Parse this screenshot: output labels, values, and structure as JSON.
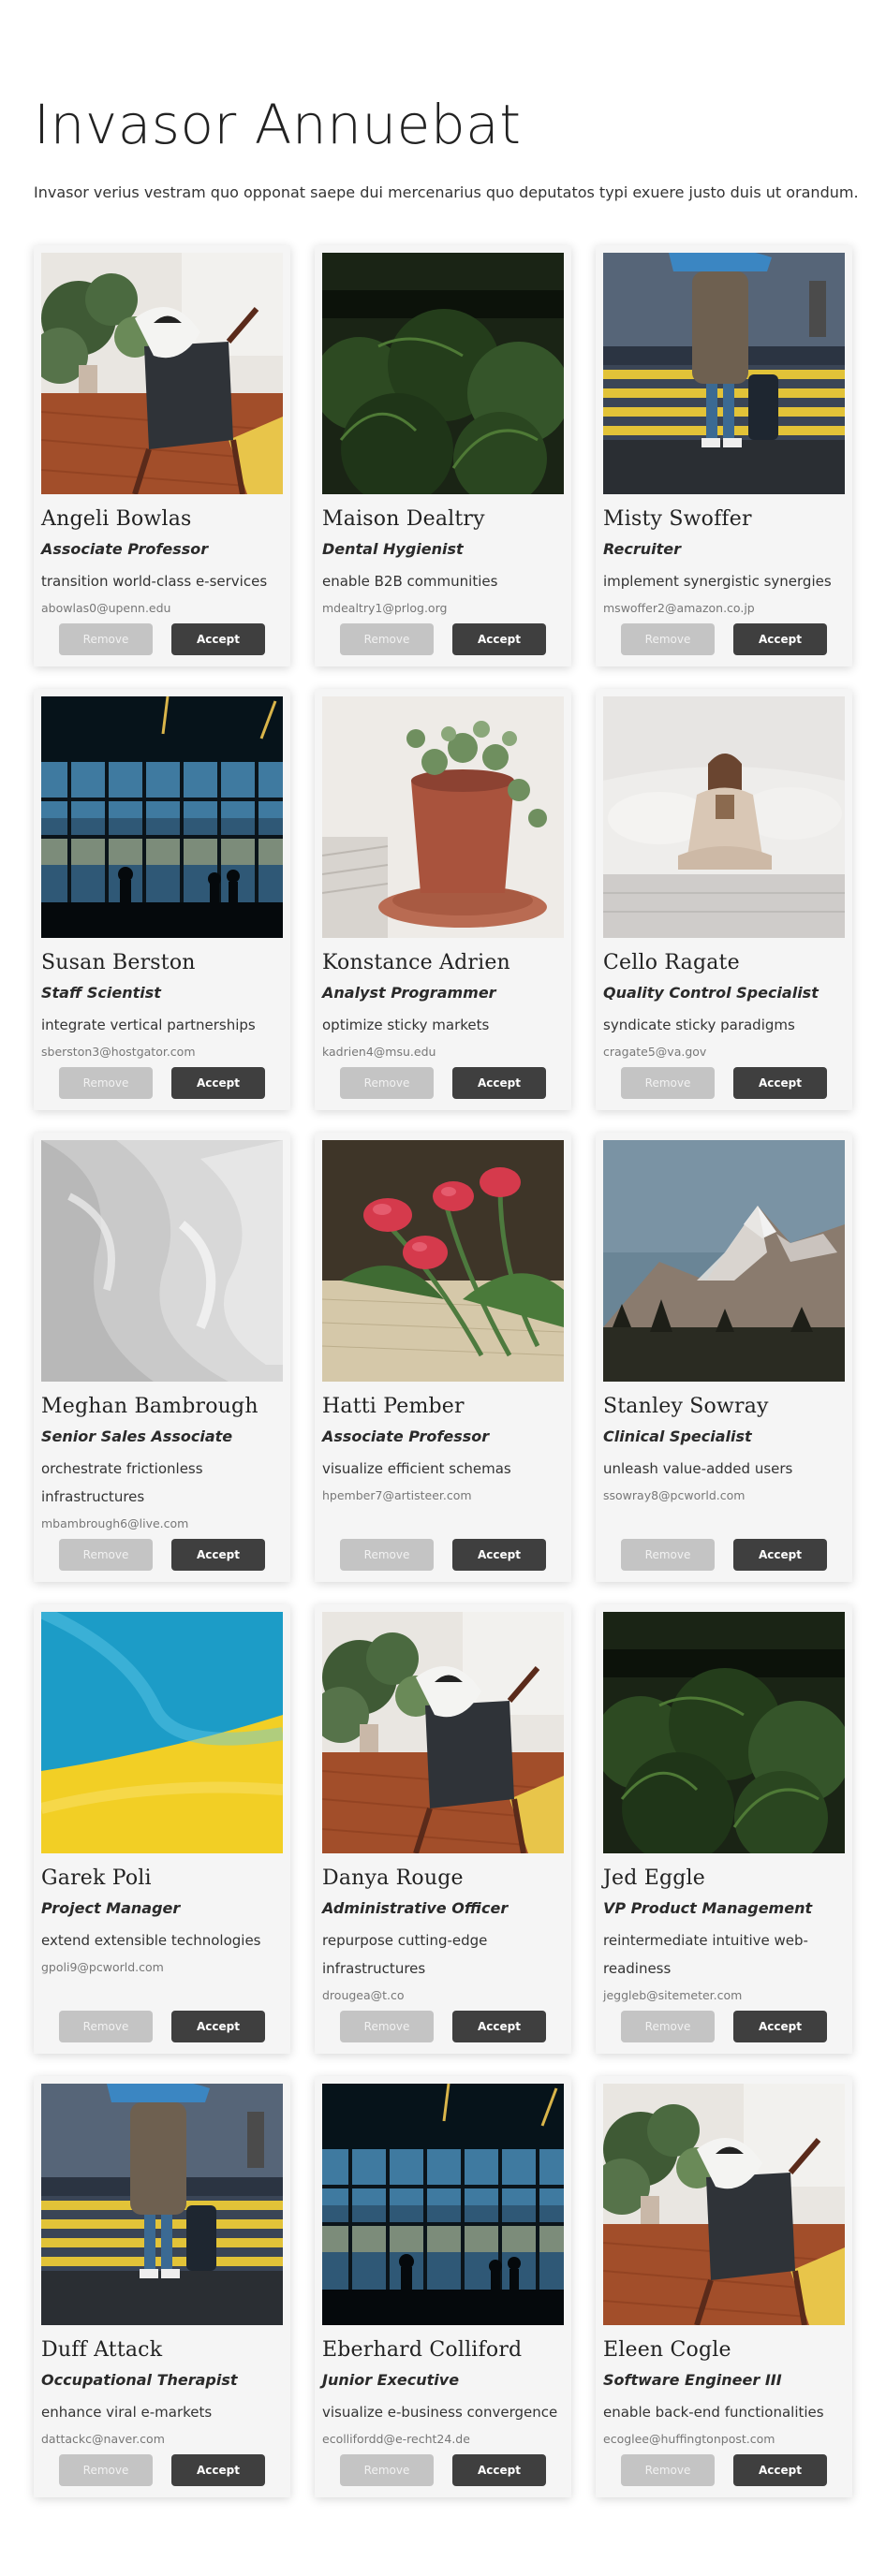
{
  "page": {
    "title": "Invasor Annuebat",
    "description": "Invasor verius vestram quo opponat saepe dui mercenarius quo deputatos typi exuere justo duis ut orandum."
  },
  "buttons": {
    "remove": "Remove",
    "accept": "Accept"
  },
  "cards": [
    {
      "name": "Angeli Bowlas",
      "role": "Associate Professor",
      "tagline": "transition world-class e-services",
      "email": "abowlas0@upenn.edu",
      "image": "living-room-chair"
    },
    {
      "name": "Maison Dealtry",
      "role": "Dental Hygienist",
      "tagline": "enable B2B communities",
      "email": "mdealtry1@prlog.org",
      "image": "forest"
    },
    {
      "name": "Misty Swoffer",
      "role": "Recruiter",
      "tagline": "implement synergistic synergies",
      "email": "mswoffer2@amazon.co.jp",
      "image": "street-crosswalk"
    },
    {
      "name": "Susan Berston",
      "role": "Staff Scientist",
      "tagline": "integrate vertical partnerships",
      "email": "sberston3@hostgator.com",
      "image": "airport-window"
    },
    {
      "name": "Konstance Adrien",
      "role": "Analyst Programmer",
      "tagline": "optimize sticky markets",
      "email": "kadrien4@msu.edu",
      "image": "potted-plant"
    },
    {
      "name": "Cello Ragate",
      "role": "Quality Control Specialist",
      "tagline": "syndicate sticky paradigms",
      "email": "cragate5@va.gov",
      "image": "woman-on-bed"
    },
    {
      "name": "Meghan Bambrough",
      "role": "Senior Sales Associate",
      "tagline": "orchestrate frictionless infrastructures",
      "email": "mbambrough6@live.com",
      "image": "white-fabric"
    },
    {
      "name": "Hatti Pember",
      "role": "Associate Professor",
      "tagline": "visualize efficient schemas",
      "email": "hpember7@artisteer.com",
      "image": "tulips"
    },
    {
      "name": "Stanley Sowray",
      "role": "Clinical Specialist",
      "tagline": "unleash value-added users",
      "email": "ssowray8@pcworld.com",
      "image": "mountain"
    },
    {
      "name": "Garek Poli",
      "role": "Project Manager",
      "tagline": "extend extensible technologies",
      "email": "gpoli9@pcworld.com",
      "image": "ukraine-flag"
    },
    {
      "name": "Danya Rouge",
      "role": "Administrative Officer",
      "tagline": "repurpose cutting-edge infrastructures",
      "email": "drougea@t.co",
      "image": "living-room-chair"
    },
    {
      "name": "Jed Eggle",
      "role": "VP Product Management",
      "tagline": "reintermediate intuitive web-readiness",
      "email": "jeggleb@sitemeter.com",
      "image": "forest"
    },
    {
      "name": "Duff Attack",
      "role": "Occupational Therapist",
      "tagline": "enhance viral e-markets",
      "email": "dattackc@naver.com",
      "image": "street-crosswalk"
    },
    {
      "name": "Eberhard Colliford",
      "role": "Junior Executive",
      "tagline": "visualize e-business convergence",
      "email": "ecollifordd@e-recht24.de",
      "image": "airport-window"
    },
    {
      "name": "Eleen Cogle",
      "role": "Software Engineer III",
      "tagline": "enable back-end functionalities",
      "email": "ecoglee@huffingtonpost.com",
      "image": "living-room-chair"
    }
  ]
}
